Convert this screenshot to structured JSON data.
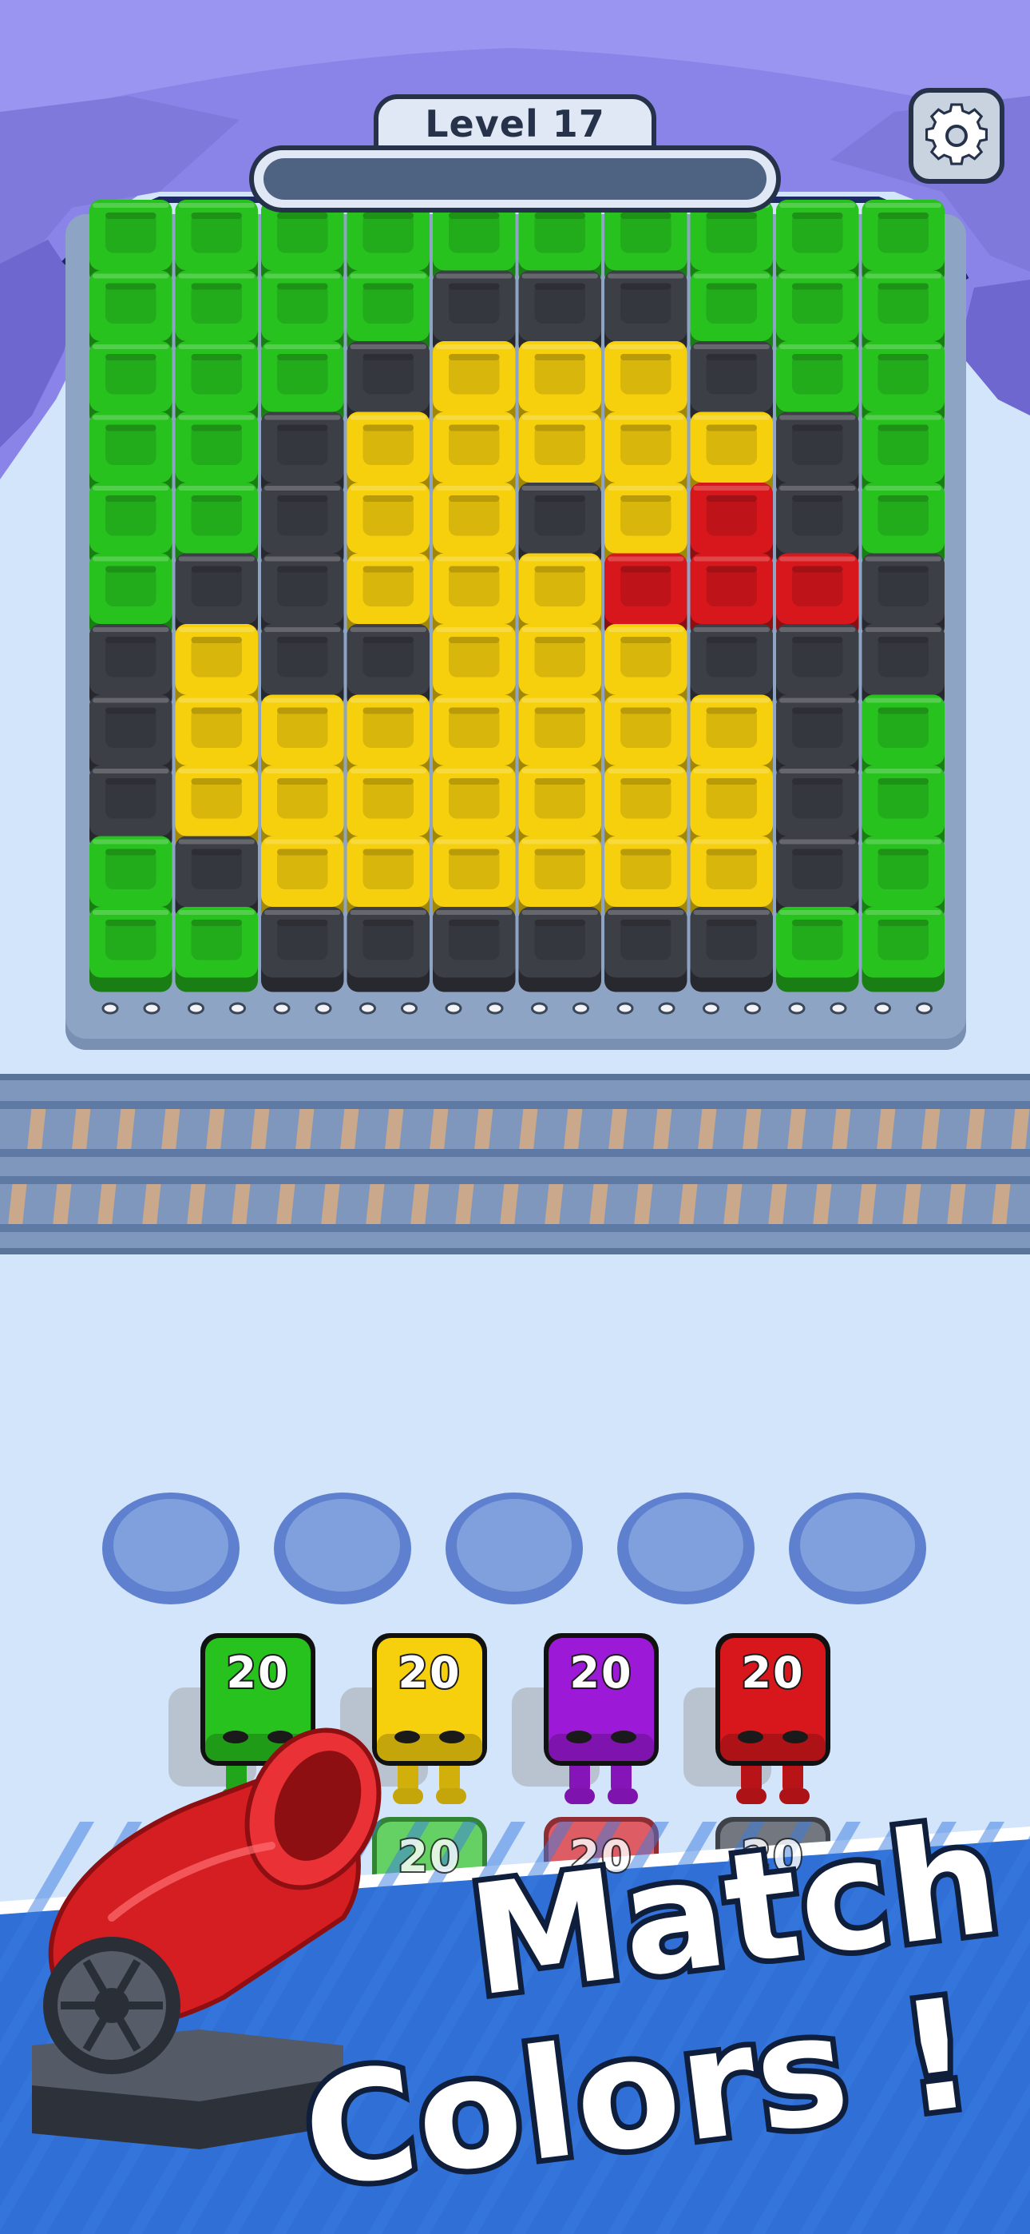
{
  "header": {
    "level_label": "Level 17",
    "progress": 0
  },
  "settings": {
    "icon": "gear-icon"
  },
  "colors": {
    "G": "#27c21e",
    "Y": "#f6cf0d",
    "K": "#3c3f46",
    "R": "#d8171c",
    "P": "#9d19d8"
  },
  "board": {
    "columns": 10,
    "rows": [
      "GGGGGGGGGG",
      "GGGGKKKGGG",
      "GGGKYYYKGG",
      "GGKYYYYYKG",
      "GGKYYKYRKG",
      "GKKYYYRRRK",
      "KYKKYYYKKK",
      "KYYYYYYYKG",
      "KYYYYYYYKG",
      "GKYYYYYYKG",
      "GGKKKKKKGG"
    ]
  },
  "holding_slots": {
    "count": 5
  },
  "shooters": [
    {
      "color": "G",
      "count": "20",
      "name": "green"
    },
    {
      "color": "Y",
      "count": "20",
      "name": "yellow"
    },
    {
      "color": "P",
      "count": "20",
      "name": "purple"
    },
    {
      "color": "R",
      "count": "20",
      "name": "red"
    }
  ],
  "queue": [
    {
      "color": "G",
      "count": "20",
      "name": "green"
    },
    {
      "color": "R",
      "count": "20",
      "name": "red"
    },
    {
      "color": "K",
      "count": "20",
      "name": "black"
    }
  ],
  "banner": {
    "line1": "Match",
    "line2": "Colors !"
  }
}
